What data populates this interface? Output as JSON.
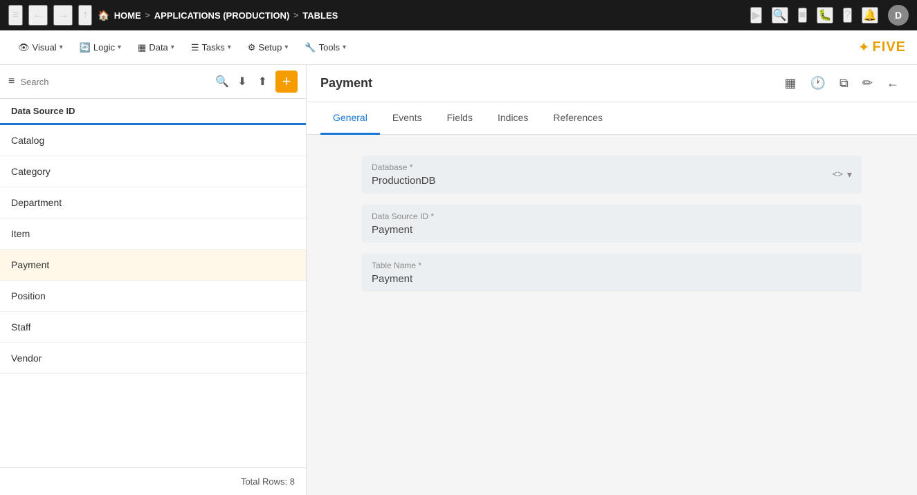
{
  "topnav": {
    "menu_icon": "≡",
    "back_icon": "←",
    "forward_icon": "→",
    "up_icon": "↑",
    "home_label": "HOME",
    "breadcrumb_sep1": ">",
    "app_label": "APPLICATIONS (PRODUCTION)",
    "breadcrumb_sep2": ">",
    "tables_label": "TABLES",
    "play_icon": "▶",
    "search_icon": "🔍",
    "stop_icon": "■",
    "person_icon": "👤",
    "help_icon": "?",
    "bell_icon": "🔔",
    "avatar_label": "D"
  },
  "toolbar": {
    "visual_label": "Visual",
    "logic_label": "Logic",
    "data_label": "Data",
    "tasks_label": "Tasks",
    "setup_label": "Setup",
    "tools_label": "Tools",
    "dropdown_arrow": "▾"
  },
  "sidebar": {
    "search_placeholder": "Search",
    "header_label": "Data Source ID",
    "items": [
      {
        "label": "Catalog",
        "active": false
      },
      {
        "label": "Category",
        "active": false
      },
      {
        "label": "Department",
        "active": false
      },
      {
        "label": "Item",
        "active": false
      },
      {
        "label": "Payment",
        "active": true
      },
      {
        "label": "Position",
        "active": false
      },
      {
        "label": "Staff",
        "active": false
      },
      {
        "label": "Vendor",
        "active": false
      }
    ],
    "footer_label": "Total Rows: 8"
  },
  "content": {
    "title": "Payment",
    "tabs": [
      {
        "label": "General",
        "active": true
      },
      {
        "label": "Events",
        "active": false
      },
      {
        "label": "Fields",
        "active": false
      },
      {
        "label": "Indices",
        "active": false
      },
      {
        "label": "References",
        "active": false
      }
    ],
    "form": {
      "database_label": "Database *",
      "database_value": "ProductionDB",
      "datasource_label": "Data Source ID *",
      "datasource_value": "Payment",
      "tablename_label": "Table Name *",
      "tablename_value": "Payment"
    }
  },
  "icons": {
    "grid_icon": "▦",
    "clock_icon": "🕐",
    "copy_icon": "⧉",
    "edit_icon": "✏",
    "back_icon": "←",
    "code_icon": "<>",
    "chevron_down": "▾"
  }
}
